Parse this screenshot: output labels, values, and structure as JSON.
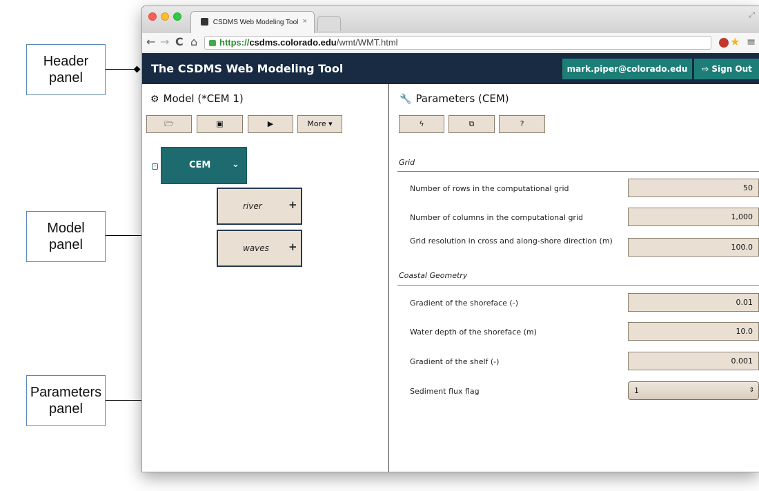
{
  "callouts": {
    "header": [
      "Header",
      "panel"
    ],
    "model": [
      "Model",
      "panel"
    ],
    "parameters": [
      "Parameters",
      "panel"
    ]
  },
  "browser": {
    "tab_title": "CSDMS Web Modeling Tool",
    "tab_close": "×",
    "url_protocol": "https://",
    "url_host": "csdms.colorado.edu",
    "url_path": "/wmt/WMT.html"
  },
  "header": {
    "title": "The CSDMS Web Modeling Tool",
    "user": "mark.piper@colorado.edu",
    "sign_out": "Sign Out"
  },
  "model": {
    "title": "Model (*CEM 1)",
    "buttons": {
      "open_icon": "folder-open-icon",
      "save_icon": "floppy-disk-icon",
      "run_icon": "play-icon",
      "more": "More"
    },
    "root": {
      "label": "CEM",
      "expanded": true
    },
    "children": [
      {
        "label": "river"
      },
      {
        "label": "waves"
      }
    ]
  },
  "parameters": {
    "title": "Parameters (CEM)",
    "buttons": {
      "bolt": "bolt-icon",
      "external": "external-link-icon",
      "help": "?"
    },
    "sections": [
      {
        "name": "Grid",
        "params": [
          {
            "label": "Number of rows in the computational grid",
            "value": "50"
          },
          {
            "label": "Number of columns in the computational grid",
            "value": "1,000"
          },
          {
            "label": "Grid resolution in cross and along-shore direction (m)",
            "value": "100.0"
          }
        ]
      },
      {
        "name": "Coastal Geometry",
        "params": [
          {
            "label": "Gradient of the shoreface (-)",
            "value": "0.01"
          },
          {
            "label": "Water depth of the shoreface (m)",
            "value": "10.0"
          },
          {
            "label": "Gradient of the shelf (-)",
            "value": "0.001"
          },
          {
            "label": "Sediment flux flag",
            "value": "1"
          }
        ]
      }
    ]
  },
  "colors": {
    "header_bg": "#182b43",
    "accent_teal": "#1d7e78",
    "node_teal": "#1d6b6e",
    "input_beige": "#e9e0d3"
  }
}
